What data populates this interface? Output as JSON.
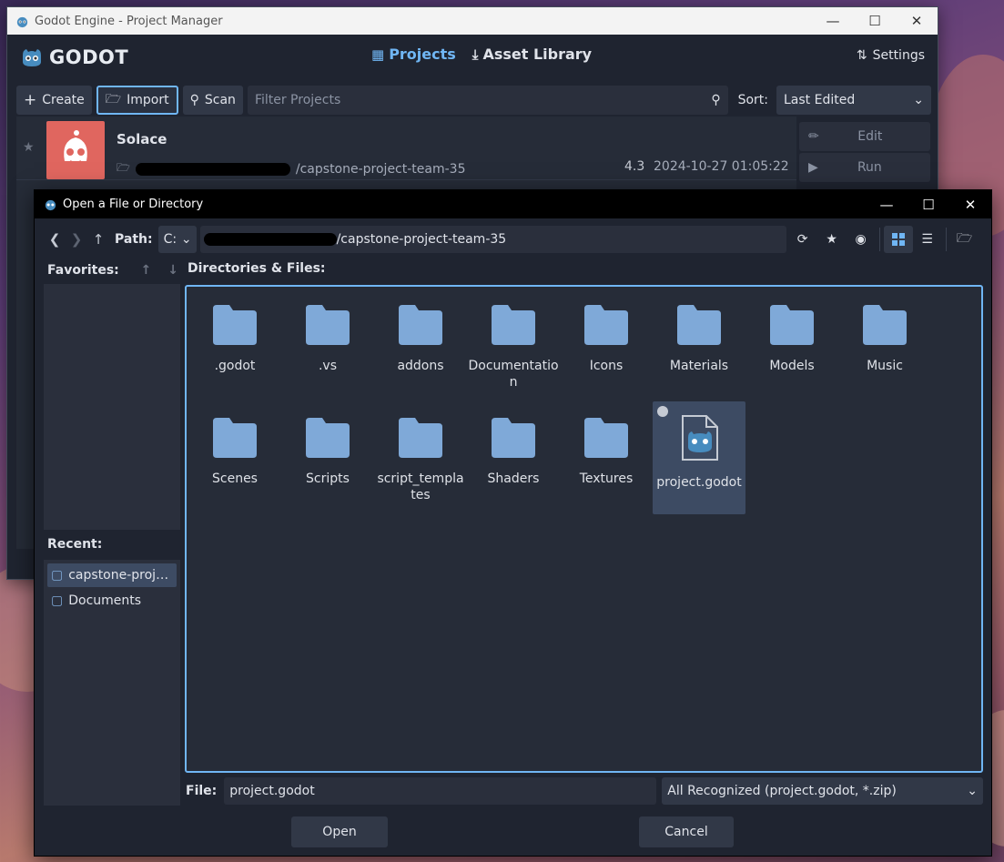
{
  "colors": {
    "accent": "#70b6f4",
    "folder": "#7fa9d8",
    "panel": "#1f2430",
    "thumb": "#e0665f"
  },
  "project_manager": {
    "window_title": "Godot Engine - Project Manager",
    "brand": "GODOT",
    "tabs": [
      {
        "label": "Projects",
        "icon": "projects-list-icon",
        "active": true
      },
      {
        "label": "Asset Library",
        "icon": "download-icon",
        "active": false
      }
    ],
    "settings_label": "Settings",
    "toolbar": {
      "create": "Create",
      "import": "Import",
      "scan": "Scan",
      "filter_placeholder": "Filter Projects",
      "sort_label": "Sort:",
      "sort_value": "Last Edited"
    },
    "project": {
      "name": "Solace",
      "path_visible": "/capstone-project-team-35",
      "version": "4.3",
      "date": "2024-10-27 01:05:22"
    },
    "side": {
      "edit": "Edit",
      "run": "Run"
    }
  },
  "dialog": {
    "title": "Open a File or Directory",
    "path_label": "Path:",
    "drive": "C:",
    "path_visible": "/capstone-project-team-35",
    "favorites_label": "Favorites:",
    "recent_label": "Recent:",
    "recent": [
      {
        "label": "capstone-proj…",
        "selected": true
      },
      {
        "label": "Documents",
        "selected": false
      }
    ],
    "dirs_label": "Directories & Files:",
    "items": [
      {
        "label": ".godot",
        "type": "folder"
      },
      {
        "label": ".vs",
        "type": "folder"
      },
      {
        "label": "addons",
        "type": "folder"
      },
      {
        "label": "Documentation",
        "type": "folder"
      },
      {
        "label": "Icons",
        "type": "folder"
      },
      {
        "label": "Materials",
        "type": "folder"
      },
      {
        "label": "Models",
        "type": "folder"
      },
      {
        "label": "Music",
        "type": "folder"
      },
      {
        "label": "Scenes",
        "type": "folder"
      },
      {
        "label": "Scripts",
        "type": "folder"
      },
      {
        "label": "script_templates",
        "type": "folder"
      },
      {
        "label": "Shaders",
        "type": "folder"
      },
      {
        "label": "Textures",
        "type": "folder"
      },
      {
        "label": "project.godot",
        "type": "file",
        "selected": true
      }
    ],
    "file_label": "File:",
    "file_value": "project.godot",
    "filter_value": "All Recognized (project.godot, *.zip)",
    "open": "Open",
    "cancel": "Cancel"
  }
}
